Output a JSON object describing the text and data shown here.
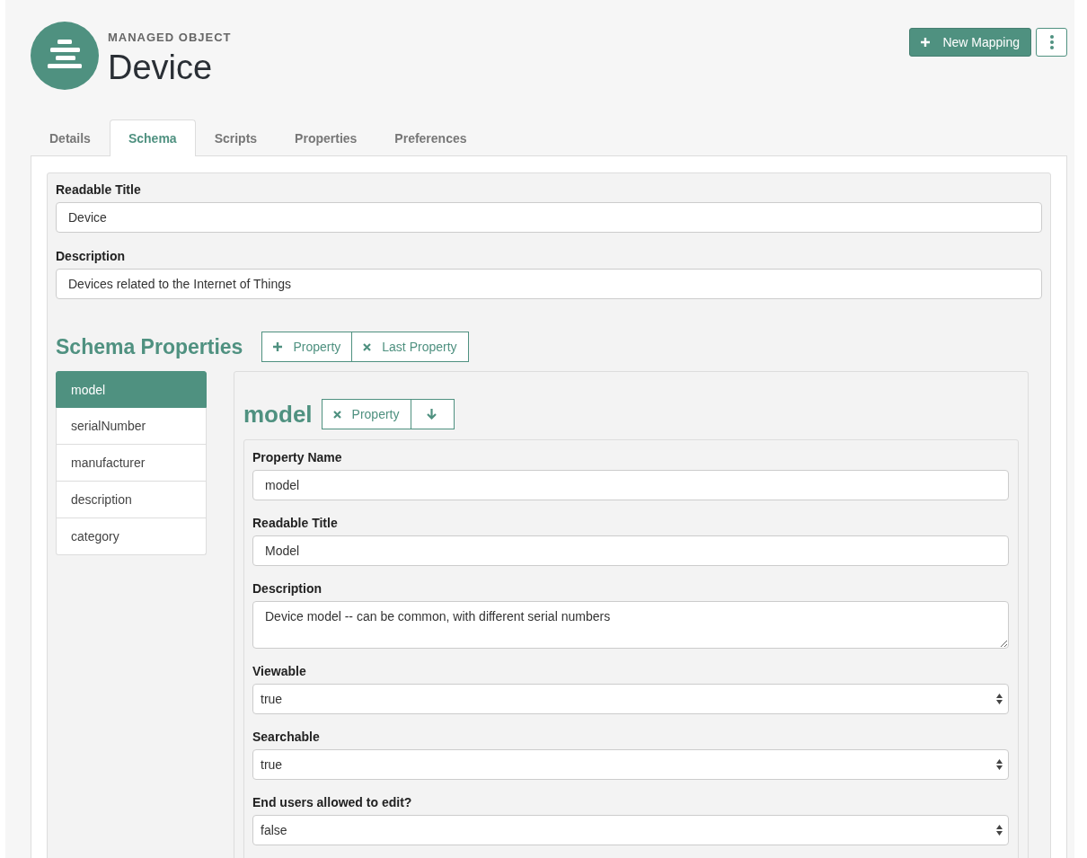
{
  "header": {
    "kicker": "MANAGED OBJECT",
    "title": "Device",
    "new_button": "New Mapping"
  },
  "tabs": [
    {
      "label": "Details",
      "selected": false
    },
    {
      "label": "Schema",
      "selected": true
    },
    {
      "label": "Scripts",
      "selected": false
    },
    {
      "label": "Properties",
      "selected": false
    },
    {
      "label": "Preferences",
      "selected": false
    }
  ],
  "object_fields": [
    {
      "label": "Readable Title",
      "kind": "input",
      "value": "Device"
    },
    {
      "label": "Description",
      "kind": "input",
      "value": "Devices related to the Internet of Things"
    }
  ],
  "schema": {
    "title": "Schema Properties",
    "actions": [
      {
        "kind": "add",
        "label": "Property"
      },
      {
        "kind": "remove",
        "label": "Last Property"
      }
    ],
    "properties": [
      {
        "name": "model",
        "selected": true
      },
      {
        "name": "serialNumber",
        "selected": false
      },
      {
        "name": "manufacturer",
        "selected": false
      },
      {
        "name": "description",
        "selected": false
      },
      {
        "name": "category",
        "selected": false
      }
    ],
    "detail": {
      "title": "model",
      "actions": [
        {
          "kind": "remove",
          "label": "Property"
        },
        {
          "kind": "move-down"
        }
      ],
      "fields": [
        {
          "label": "Property Name",
          "kind": "input",
          "value": "model"
        },
        {
          "label": "Readable Title",
          "kind": "input",
          "value": "Model"
        },
        {
          "label": "Description",
          "kind": "textarea",
          "value": "Device model -- can be common, with different serial numbers"
        },
        {
          "label": "Viewable",
          "kind": "select",
          "value": "true"
        },
        {
          "label": "Searchable",
          "kind": "select",
          "value": "true"
        },
        {
          "label": "End users allowed to edit?",
          "kind": "select",
          "value": "false"
        }
      ]
    }
  }
}
